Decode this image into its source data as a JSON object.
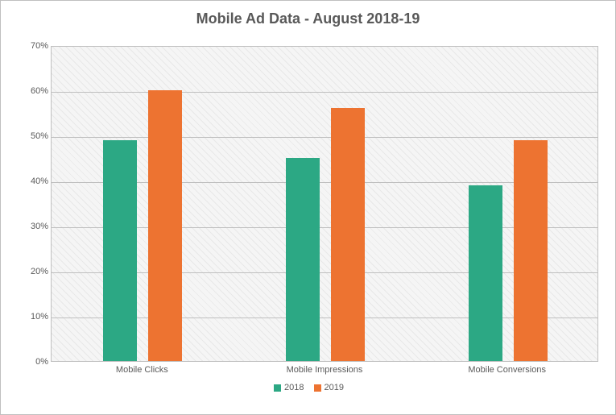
{
  "chart_data": {
    "type": "bar",
    "title": "Mobile Ad Data - August 2018-19",
    "categories": [
      "Mobile Clicks",
      "Mobile Impressions",
      "Mobile Conversions"
    ],
    "series": [
      {
        "name": "2018",
        "color": "#2ca884",
        "values": [
          49,
          45,
          39
        ]
      },
      {
        "name": "2019",
        "color": "#ed7331",
        "values": [
          60,
          56,
          49
        ]
      }
    ],
    "ylabel": "",
    "xlabel": "",
    "ylim": [
      0,
      70
    ],
    "y_ticks": [
      0,
      10,
      20,
      30,
      40,
      50,
      60,
      70
    ],
    "y_tick_format": "percent"
  }
}
